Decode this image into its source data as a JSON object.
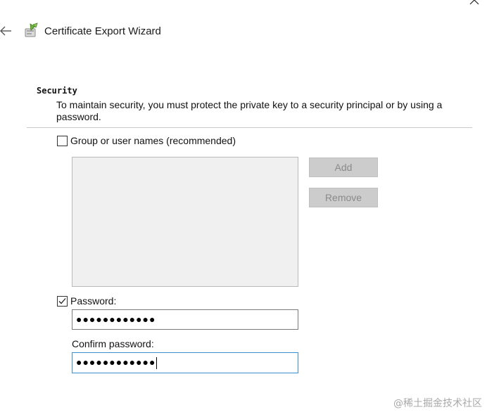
{
  "window": {
    "title": "Certificate Export Wizard",
    "back_icon": "back-arrow-icon",
    "close_icon": "close-icon",
    "wizard_icon": "certificate-icon"
  },
  "security": {
    "heading": "Security",
    "description": "To maintain security, you must protect the private key to a security principal or by using a password."
  },
  "group_option": {
    "label": "Group or user names (recommended)",
    "checked": false
  },
  "list_buttons": {
    "add_label": "Add",
    "remove_label": "Remove"
  },
  "password_option": {
    "label": "Password:",
    "checked": true,
    "masked_value": "●●●●●●●●●●●●"
  },
  "confirm": {
    "label": "Confirm password:",
    "masked_value": "●●●●●●●●●●●●"
  },
  "watermark": "@稀土掘金技术社区",
  "colors": {
    "focus_border": "#3a8fcf",
    "disabled_button": "#cccccc",
    "list_background": "#f0f0f0"
  }
}
